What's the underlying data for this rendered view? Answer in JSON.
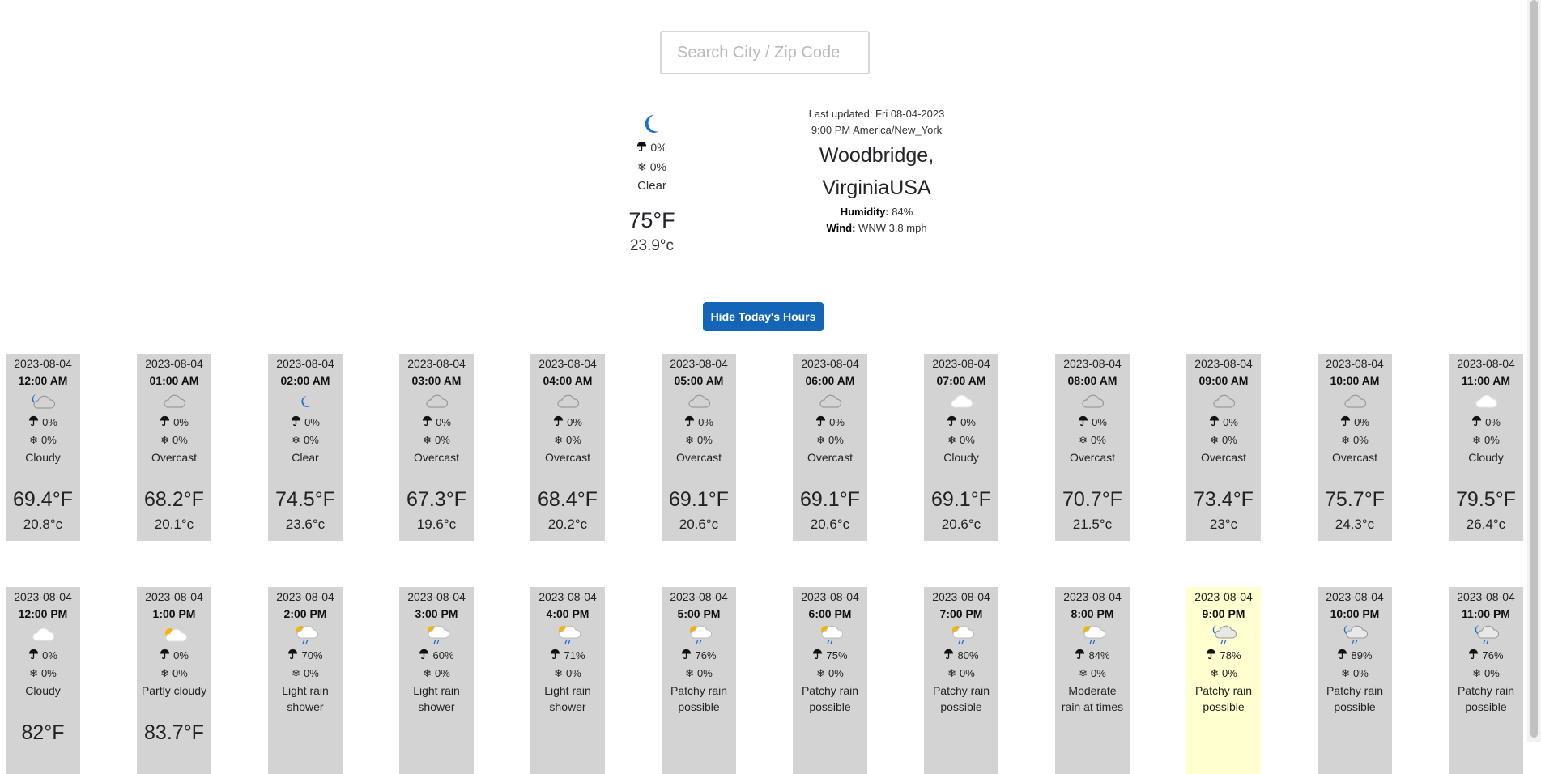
{
  "search": {
    "placeholder": "Search City / Zip Code",
    "value": ""
  },
  "current": {
    "icon": "moon",
    "rain": "0%",
    "snow": "0%",
    "condition": "Clear",
    "temp_f": "75°F",
    "temp_c": "23.9°c",
    "last_updated_line1": "Last updated: Fri 08-04-2023",
    "last_updated_line2": "9:00 PM America/New_York",
    "city_line1": "Woodbridge,",
    "city_line2": "VirginiaUSA",
    "humidity_label": "Humidity:",
    "humidity": "84%",
    "wind_label": "Wind:",
    "wind": "WNW 3.8 mph"
  },
  "hide_button_label": "Hide Today's Hours",
  "hours": [
    {
      "date": "2023-08-04",
      "time": "12:00 AM",
      "icon": "moon-cloud",
      "rain": "0%",
      "snow": "0%",
      "cond": "Cloudy",
      "f": "69.4°F",
      "c": "20.8°c"
    },
    {
      "date": "2023-08-04",
      "time": "01:00 AM",
      "icon": "cloud-outline",
      "rain": "0%",
      "snow": "0%",
      "cond": "Overcast",
      "f": "68.2°F",
      "c": "20.1°c"
    },
    {
      "date": "2023-08-04",
      "time": "02:00 AM",
      "icon": "moon",
      "rain": "0%",
      "snow": "0%",
      "cond": "Clear",
      "f": "74.5°F",
      "c": "23.6°c"
    },
    {
      "date": "2023-08-04",
      "time": "03:00 AM",
      "icon": "cloud-outline",
      "rain": "0%",
      "snow": "0%",
      "cond": "Overcast",
      "f": "67.3°F",
      "c": "19.6°c"
    },
    {
      "date": "2023-08-04",
      "time": "04:00 AM",
      "icon": "cloud-outline",
      "rain": "0%",
      "snow": "0%",
      "cond": "Overcast",
      "f": "68.4°F",
      "c": "20.2°c"
    },
    {
      "date": "2023-08-04",
      "time": "05:00 AM",
      "icon": "cloud-outline",
      "rain": "0%",
      "snow": "0%",
      "cond": "Overcast",
      "f": "69.1°F",
      "c": "20.6°c"
    },
    {
      "date": "2023-08-04",
      "time": "06:00 AM",
      "icon": "cloud-outline",
      "rain": "0%",
      "snow": "0%",
      "cond": "Overcast",
      "f": "69.1°F",
      "c": "20.6°c"
    },
    {
      "date": "2023-08-04",
      "time": "07:00 AM",
      "icon": "cloud-white",
      "rain": "0%",
      "snow": "0%",
      "cond": "Cloudy",
      "f": "69.1°F",
      "c": "20.6°c"
    },
    {
      "date": "2023-08-04",
      "time": "08:00 AM",
      "icon": "cloud-outline",
      "rain": "0%",
      "snow": "0%",
      "cond": "Overcast",
      "f": "70.7°F",
      "c": "21.5°c"
    },
    {
      "date": "2023-08-04",
      "time": "09:00 AM",
      "icon": "cloud-outline",
      "rain": "0%",
      "snow": "0%",
      "cond": "Overcast",
      "f": "73.4°F",
      "c": "23°c"
    },
    {
      "date": "2023-08-04",
      "time": "10:00 AM",
      "icon": "cloud-outline",
      "rain": "0%",
      "snow": "0%",
      "cond": "Overcast",
      "f": "75.7°F",
      "c": "24.3°c"
    },
    {
      "date": "2023-08-04",
      "time": "11:00 AM",
      "icon": "cloud-white",
      "rain": "0%",
      "snow": "0%",
      "cond": "Cloudy",
      "f": "79.5°F",
      "c": "26.4°c"
    },
    {
      "date": "2023-08-04",
      "time": "12:00 PM",
      "icon": "cloud-white",
      "rain": "0%",
      "snow": "0%",
      "cond": "Cloudy",
      "f": "82°F",
      "c": ""
    },
    {
      "date": "2023-08-04",
      "time": "1:00 PM",
      "icon": "sun-cloud",
      "rain": "0%",
      "snow": "0%",
      "cond": "Partly cloudy",
      "f": "83.7°F",
      "c": ""
    },
    {
      "date": "2023-08-04",
      "time": "2:00 PM",
      "icon": "sun-rain",
      "rain": "70%",
      "snow": "0%",
      "cond": "Light rain shower",
      "f": "",
      "c": ""
    },
    {
      "date": "2023-08-04",
      "time": "3:00 PM",
      "icon": "sun-rain",
      "rain": "60%",
      "snow": "0%",
      "cond": "Light rain shower",
      "f": "",
      "c": ""
    },
    {
      "date": "2023-08-04",
      "time": "4:00 PM",
      "icon": "sun-rain",
      "rain": "71%",
      "snow": "0%",
      "cond": "Light rain shower",
      "f": "",
      "c": ""
    },
    {
      "date": "2023-08-04",
      "time": "5:00 PM",
      "icon": "sun-rain",
      "rain": "76%",
      "snow": "0%",
      "cond": "Patchy rain possible",
      "f": "",
      "c": ""
    },
    {
      "date": "2023-08-04",
      "time": "6:00 PM",
      "icon": "sun-rain",
      "rain": "75%",
      "snow": "0%",
      "cond": "Patchy rain possible",
      "f": "",
      "c": ""
    },
    {
      "date": "2023-08-04",
      "time": "7:00 PM",
      "icon": "sun-rain",
      "rain": "80%",
      "snow": "0%",
      "cond": "Patchy rain possible",
      "f": "",
      "c": ""
    },
    {
      "date": "2023-08-04",
      "time": "8:00 PM",
      "icon": "sun-rain",
      "rain": "84%",
      "snow": "0%",
      "cond": "Moderate rain at times",
      "f": "",
      "c": ""
    },
    {
      "date": "2023-08-04",
      "time": "9:00 PM",
      "icon": "moon-rain",
      "rain": "78%",
      "snow": "0%",
      "cond": "Patchy rain possible",
      "f": "",
      "c": "",
      "current": true
    },
    {
      "date": "2023-08-04",
      "time": "10:00 PM",
      "icon": "moon-rain",
      "rain": "89%",
      "snow": "0%",
      "cond": "Patchy rain possible",
      "f": "",
      "c": ""
    },
    {
      "date": "2023-08-04",
      "time": "11:00 PM",
      "icon": "moon-rain",
      "rain": "76%",
      "snow": "0%",
      "cond": "Patchy rain possible",
      "f": "",
      "c": ""
    }
  ]
}
